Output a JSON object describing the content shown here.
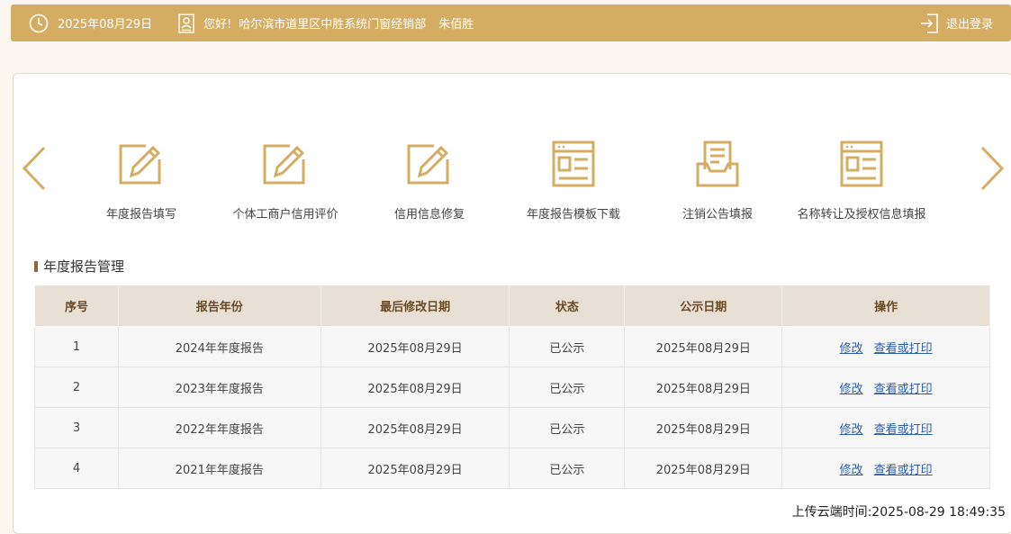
{
  "header": {
    "date": "2025年08月29日",
    "greeting": "您好!",
    "org": "哈尔滨市道里区中胜系统门窗经销部",
    "user": "朱佰胜",
    "logout_label": "退出登录"
  },
  "shortcuts": [
    {
      "label": "年度报告填写",
      "icon": "edit-icon"
    },
    {
      "label": "个体工商户信用评价",
      "icon": "edit-icon"
    },
    {
      "label": "信用信息修复",
      "icon": "edit-icon"
    },
    {
      "label": "年度报告模板下载",
      "icon": "template-icon"
    },
    {
      "label": "注销公告填报",
      "icon": "document-tray-icon"
    },
    {
      "label": "名称转让及授权信息填报",
      "icon": "template-icon"
    }
  ],
  "section": {
    "title": "年度报告管理"
  },
  "table": {
    "headers": [
      "序号",
      "报告年份",
      "最后修改日期",
      "状态",
      "公示日期",
      "操作"
    ],
    "rows": [
      {
        "no": "1",
        "year": "2024年年度报告",
        "modified": "2025年08月29日",
        "status": "已公示",
        "published": "2025年08月29日"
      },
      {
        "no": "2",
        "year": "2023年年度报告",
        "modified": "2025年08月29日",
        "status": "已公示",
        "published": "2025年08月29日"
      },
      {
        "no": "3",
        "year": "2022年年度报告",
        "modified": "2025年08月29日",
        "status": "已公示",
        "published": "2025年08月29日"
      },
      {
        "no": "4",
        "year": "2021年年度报告",
        "modified": "2025年08月29日",
        "status": "已公示",
        "published": "2025年08月29日"
      }
    ],
    "actions": {
      "edit": "修改",
      "view": "查看或打印"
    }
  },
  "footer": {
    "upload_time": "上传云端时间:2025-08-29 18:49:35"
  },
  "colors": {
    "accent": "#d4ad62",
    "header_bg": "#e8e0d5",
    "link": "#2a5db0"
  }
}
